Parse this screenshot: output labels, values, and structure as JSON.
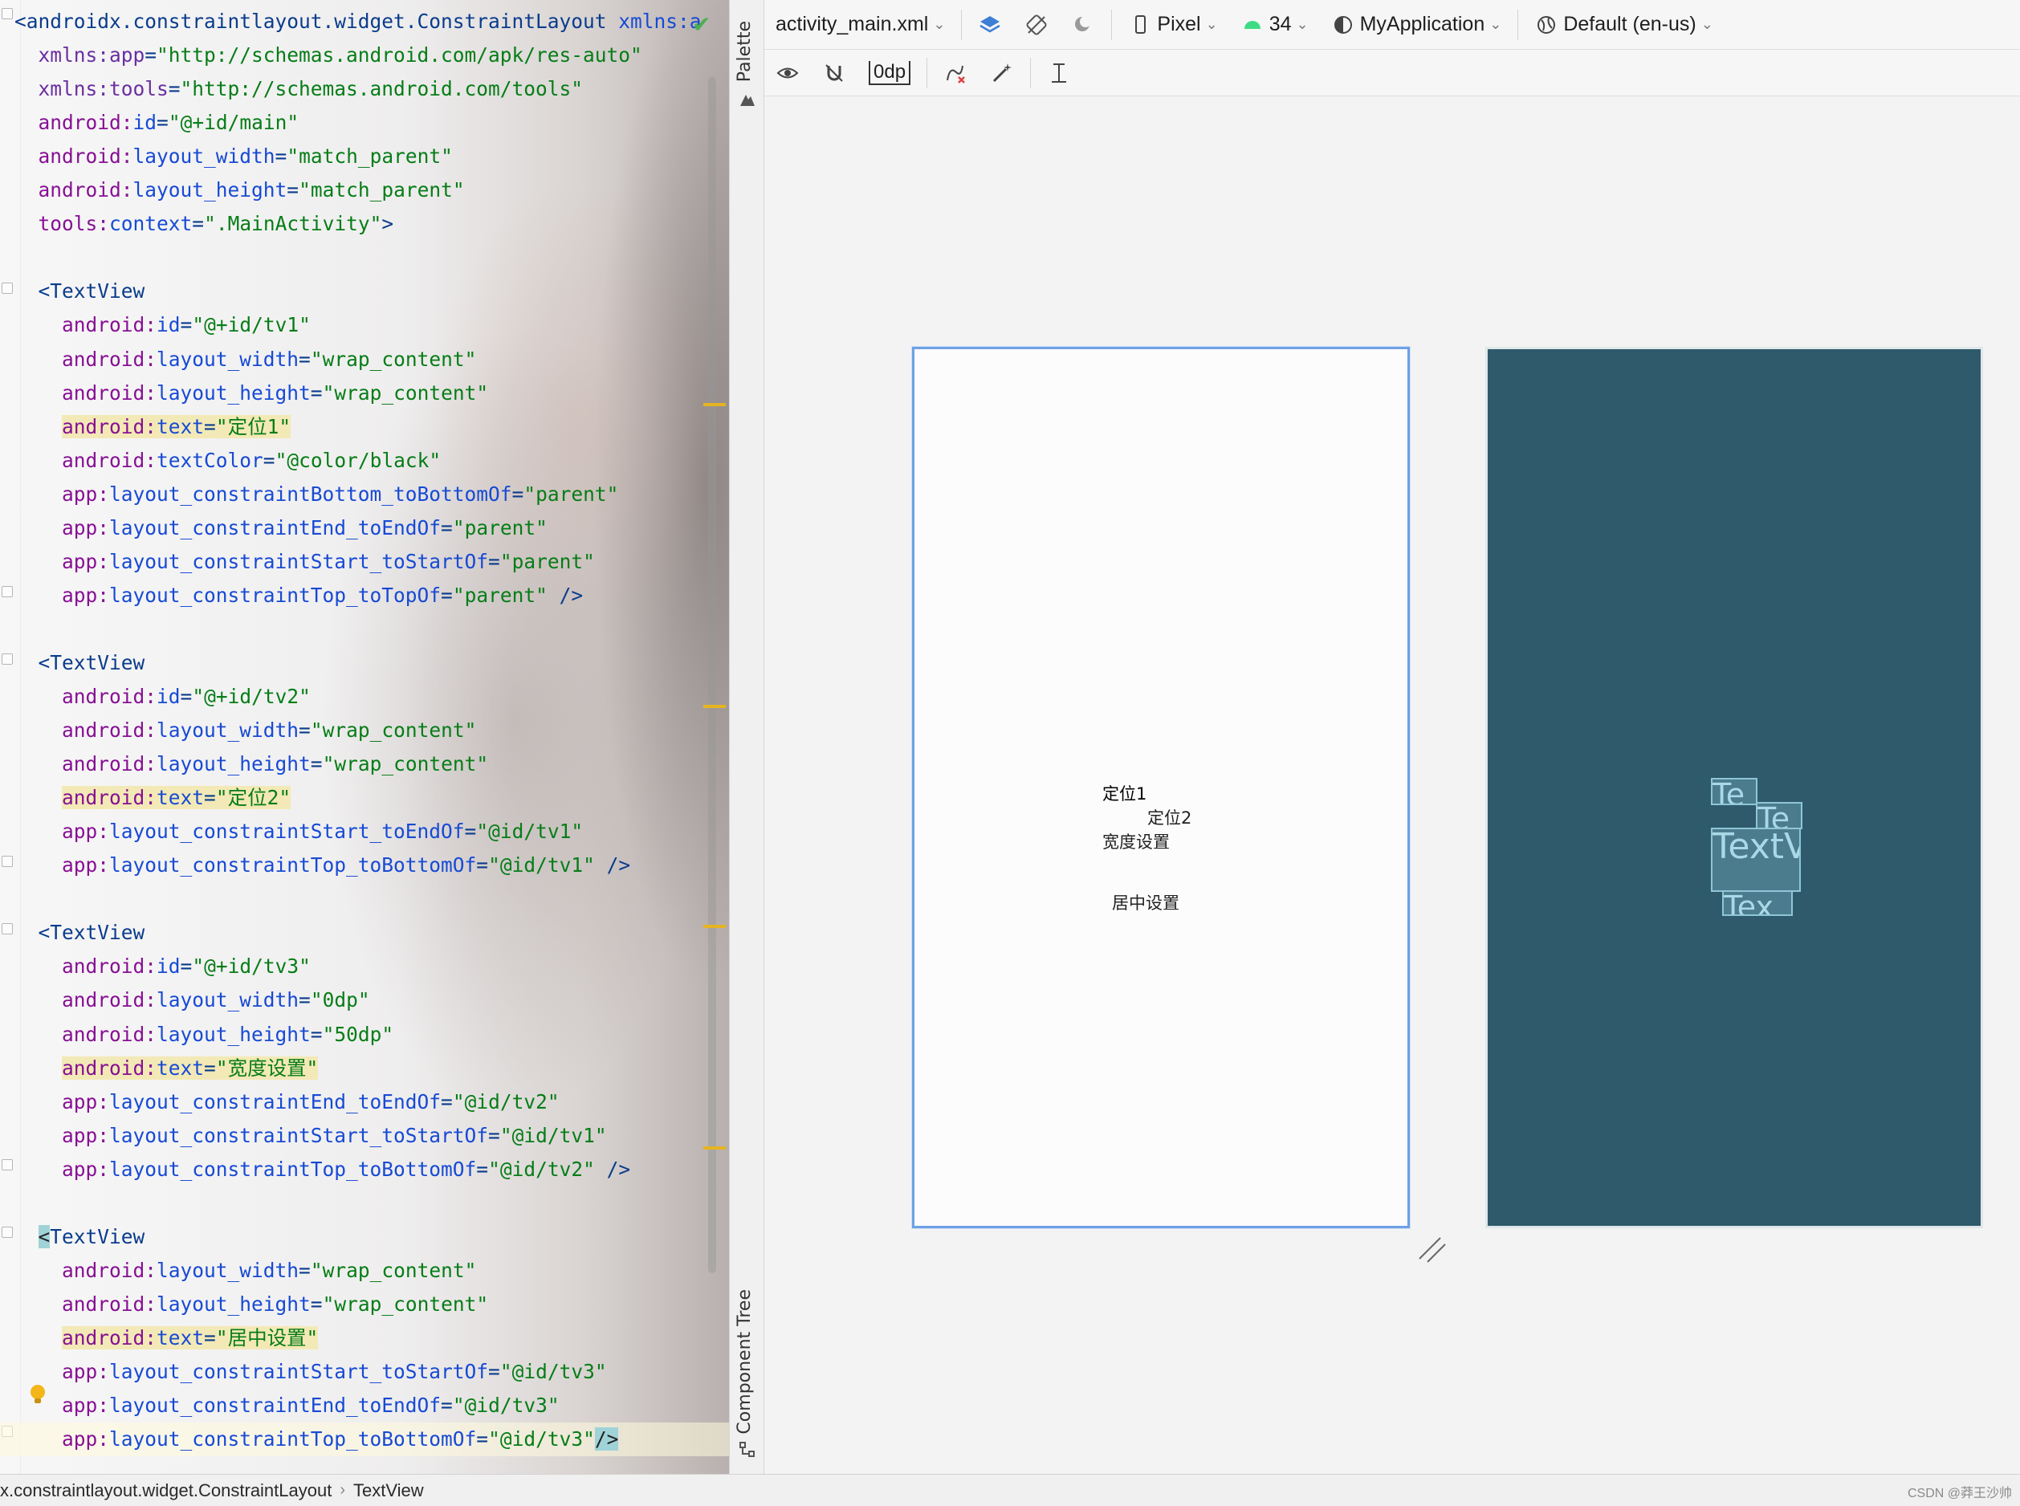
{
  "editor": {
    "lines": [
      {
        "y": 0,
        "indent": 0,
        "parts": [
          [
            "pun",
            "<"
          ],
          [
            "tag",
            "androidx.constraintlayout.widget.ConstraintLayout "
          ],
          [
            "attr",
            "xmlns:a"
          ]
        ]
      },
      {
        "indent": 1,
        "parts": [
          [
            "attr-plain",
            "xmlns:app"
          ],
          [
            "pun",
            "="
          ],
          [
            "str",
            "\"http://schemas.android.com/apk/res-auto\""
          ]
        ]
      },
      {
        "indent": 1,
        "parts": [
          [
            "attr-plain",
            "xmlns:tools"
          ],
          [
            "pun",
            "="
          ],
          [
            "str",
            "\"http://schemas.android.com/tools\""
          ]
        ]
      },
      {
        "indent": 1,
        "parts": [
          [
            "attr-ns",
            "android:"
          ],
          [
            "attr",
            "id"
          ],
          [
            "pun",
            "="
          ],
          [
            "str",
            "\"@+id/main\""
          ]
        ]
      },
      {
        "indent": 1,
        "parts": [
          [
            "attr-ns",
            "android:"
          ],
          [
            "attr",
            "layout_width"
          ],
          [
            "pun",
            "="
          ],
          [
            "str",
            "\"match_parent\""
          ]
        ]
      },
      {
        "indent": 1,
        "parts": [
          [
            "attr-ns",
            "android:"
          ],
          [
            "attr",
            "layout_height"
          ],
          [
            "pun",
            "="
          ],
          [
            "str",
            "\"match_parent\""
          ]
        ]
      },
      {
        "indent": 1,
        "parts": [
          [
            "attr-ns",
            "tools:"
          ],
          [
            "attr",
            "context"
          ],
          [
            "pun",
            "="
          ],
          [
            "str",
            "\".MainActivity\""
          ],
          [
            "pun",
            ">"
          ]
        ]
      },
      {
        "indent": 0,
        "parts": []
      },
      {
        "indent": 1,
        "parts": [
          [
            "pun",
            "<"
          ],
          [
            "tag",
            "TextView"
          ]
        ]
      },
      {
        "indent": 2,
        "parts": [
          [
            "attr-ns",
            "android:"
          ],
          [
            "attr",
            "id"
          ],
          [
            "pun",
            "="
          ],
          [
            "str",
            "\"@+id/tv1\""
          ]
        ]
      },
      {
        "indent": 2,
        "parts": [
          [
            "attr-ns",
            "android:"
          ],
          [
            "attr",
            "layout_width"
          ],
          [
            "pun",
            "="
          ],
          [
            "str",
            "\"wrap_content\""
          ]
        ]
      },
      {
        "indent": 2,
        "parts": [
          [
            "attr-ns",
            "android:"
          ],
          [
            "attr",
            "layout_height"
          ],
          [
            "pun",
            "="
          ],
          [
            "str",
            "\"wrap_content\""
          ]
        ]
      },
      {
        "indent": 2,
        "hl": true,
        "parts": [
          [
            "attr-ns",
            "android:"
          ],
          [
            "attr",
            "text"
          ],
          [
            "pun",
            "="
          ],
          [
            "str",
            "\"定位1\""
          ]
        ]
      },
      {
        "indent": 2,
        "parts": [
          [
            "attr-ns",
            "android:"
          ],
          [
            "attr",
            "textColor"
          ],
          [
            "pun",
            "="
          ],
          [
            "str",
            "\"@color/black\""
          ]
        ]
      },
      {
        "indent": 2,
        "parts": [
          [
            "attr-ns",
            "app:"
          ],
          [
            "attr",
            "layout_constraintBottom_toBottomOf"
          ],
          [
            "pun",
            "="
          ],
          [
            "str",
            "\"parent\""
          ]
        ]
      },
      {
        "indent": 2,
        "parts": [
          [
            "attr-ns",
            "app:"
          ],
          [
            "attr",
            "layout_constraintEnd_toEndOf"
          ],
          [
            "pun",
            "="
          ],
          [
            "str",
            "\"parent\""
          ]
        ]
      },
      {
        "indent": 2,
        "parts": [
          [
            "attr-ns",
            "app:"
          ],
          [
            "attr",
            "layout_constraintStart_toStartOf"
          ],
          [
            "pun",
            "="
          ],
          [
            "str",
            "\"parent\""
          ]
        ]
      },
      {
        "indent": 2,
        "parts": [
          [
            "attr-ns",
            "app:"
          ],
          [
            "attr",
            "layout_constraintTop_toTopOf"
          ],
          [
            "pun",
            "="
          ],
          [
            "str",
            "\"parent\""
          ],
          [
            "pun",
            " />"
          ]
        ]
      },
      {
        "indent": 0,
        "parts": []
      },
      {
        "indent": 1,
        "parts": [
          [
            "pun",
            "<"
          ],
          [
            "tag",
            "TextView"
          ]
        ]
      },
      {
        "indent": 2,
        "parts": [
          [
            "attr-ns",
            "android:"
          ],
          [
            "attr",
            "id"
          ],
          [
            "pun",
            "="
          ],
          [
            "str",
            "\"@+id/tv2\""
          ]
        ]
      },
      {
        "indent": 2,
        "parts": [
          [
            "attr-ns",
            "android:"
          ],
          [
            "attr",
            "layout_width"
          ],
          [
            "pun",
            "="
          ],
          [
            "str",
            "\"wrap_content\""
          ]
        ]
      },
      {
        "indent": 2,
        "parts": [
          [
            "attr-ns",
            "android:"
          ],
          [
            "attr",
            "layout_height"
          ],
          [
            "pun",
            "="
          ],
          [
            "str",
            "\"wrap_content\""
          ]
        ]
      },
      {
        "indent": 2,
        "hl": true,
        "parts": [
          [
            "attr-ns",
            "android:"
          ],
          [
            "attr",
            "text"
          ],
          [
            "pun",
            "="
          ],
          [
            "str",
            "\"定位2\""
          ]
        ]
      },
      {
        "indent": 2,
        "parts": [
          [
            "attr-ns",
            "app:"
          ],
          [
            "attr",
            "layout_constraintStart_toEndOf"
          ],
          [
            "pun",
            "="
          ],
          [
            "str",
            "\"@id/tv1\""
          ]
        ]
      },
      {
        "indent": 2,
        "parts": [
          [
            "attr-ns",
            "app:"
          ],
          [
            "attr",
            "layout_constraintTop_toBottomOf"
          ],
          [
            "pun",
            "="
          ],
          [
            "str",
            "\"@id/tv1\""
          ],
          [
            "pun",
            " />"
          ]
        ]
      },
      {
        "indent": 0,
        "parts": []
      },
      {
        "indent": 1,
        "parts": [
          [
            "pun",
            "<"
          ],
          [
            "tag",
            "TextView"
          ]
        ]
      },
      {
        "indent": 2,
        "parts": [
          [
            "attr-ns",
            "android:"
          ],
          [
            "attr",
            "id"
          ],
          [
            "pun",
            "="
          ],
          [
            "str",
            "\"@+id/tv3\""
          ]
        ]
      },
      {
        "indent": 2,
        "parts": [
          [
            "attr-ns",
            "android:"
          ],
          [
            "attr",
            "layout_width"
          ],
          [
            "pun",
            "="
          ],
          [
            "str",
            "\"0dp\""
          ]
        ]
      },
      {
        "indent": 2,
        "parts": [
          [
            "attr-ns",
            "android:"
          ],
          [
            "attr",
            "layout_height"
          ],
          [
            "pun",
            "="
          ],
          [
            "str",
            "\"50dp\""
          ]
        ]
      },
      {
        "indent": 2,
        "hl": true,
        "parts": [
          [
            "attr-ns",
            "android:"
          ],
          [
            "attr",
            "text"
          ],
          [
            "pun",
            "="
          ],
          [
            "str",
            "\"宽度设置\""
          ]
        ]
      },
      {
        "indent": 2,
        "parts": [
          [
            "attr-ns",
            "app:"
          ],
          [
            "attr",
            "layout_constraintEnd_toEndOf"
          ],
          [
            "pun",
            "="
          ],
          [
            "str",
            "\"@id/tv2\""
          ]
        ]
      },
      {
        "indent": 2,
        "parts": [
          [
            "attr-ns",
            "app:"
          ],
          [
            "attr",
            "layout_constraintStart_toStartOf"
          ],
          [
            "pun",
            "="
          ],
          [
            "str",
            "\"@id/tv1\""
          ]
        ]
      },
      {
        "indent": 2,
        "parts": [
          [
            "attr-ns",
            "app:"
          ],
          [
            "attr",
            "layout_constraintTop_toBottomOf"
          ],
          [
            "pun",
            "="
          ],
          [
            "str",
            "\"@id/tv2\""
          ],
          [
            "pun",
            " />"
          ]
        ]
      },
      {
        "indent": 0,
        "parts": []
      },
      {
        "indent": 1,
        "parts": [
          [
            "caret",
            "<"
          ],
          [
            "tag",
            "TextView"
          ]
        ]
      },
      {
        "indent": 2,
        "parts": [
          [
            "attr-ns",
            "android:"
          ],
          [
            "attr",
            "layout_width"
          ],
          [
            "pun",
            "="
          ],
          [
            "str",
            "\"wrap_content\""
          ]
        ]
      },
      {
        "indent": 2,
        "parts": [
          [
            "attr-ns",
            "android:"
          ],
          [
            "attr",
            "layout_height"
          ],
          [
            "pun",
            "="
          ],
          [
            "str",
            "\"wrap_content\""
          ]
        ]
      },
      {
        "indent": 2,
        "hl": true,
        "parts": [
          [
            "attr-ns",
            "android:"
          ],
          [
            "attr",
            "text"
          ],
          [
            "pun",
            "="
          ],
          [
            "str",
            "\"居中设置\""
          ]
        ]
      },
      {
        "indent": 2,
        "parts": [
          [
            "attr-ns",
            "app:"
          ],
          [
            "attr",
            "layout_constraintStart_toStartOf"
          ],
          [
            "pun",
            "="
          ],
          [
            "str",
            "\"@id/tv3\""
          ]
        ]
      },
      {
        "indent": 2,
        "parts": [
          [
            "attr-ns",
            "app:"
          ],
          [
            "attr",
            "layout_constraintEnd_toEndOf"
          ],
          [
            "pun",
            "="
          ],
          [
            "str",
            "\"@id/tv3\""
          ]
        ]
      },
      {
        "indent": 2,
        "current": true,
        "parts": [
          [
            "attr-ns",
            "app:"
          ],
          [
            "attr",
            "layout_constraintTop_toBottomOf"
          ],
          [
            "pun",
            "="
          ],
          [
            "str",
            "\"@id/tv3\""
          ],
          [
            "caret",
            "/>"
          ]
        ]
      }
    ]
  },
  "side_strip": {
    "palette_label": "Palette",
    "component_tree_label": "Component Tree"
  },
  "toolbar": {
    "file_name": "activity_main.xml",
    "device": "Pixel",
    "api_level": "34",
    "theme": "MyApplication",
    "locale": "Default (en-us)",
    "default_margin": "0dp"
  },
  "design_preview": {
    "tv1": "定位1",
    "tv2": "定位2",
    "tv3": "宽度设置",
    "tv4": "居中设置"
  },
  "blueprint": {
    "box1": "Te",
    "box2": "Te",
    "box3": "TextV",
    "box4": "Tex"
  },
  "statusbar": {
    "crumb1": "x.constraintlayout.widget.ConstraintLayout",
    "crumb2": "TextView",
    "watermark": "CSDN @莽王沙帅"
  },
  "colors": {
    "blueprint_bg": "#2e5a6b",
    "selection_blue": "#6ea0e6",
    "string_green": "#067d17",
    "attr_blue": "#174ad4",
    "namespace_purple": "#871094"
  }
}
